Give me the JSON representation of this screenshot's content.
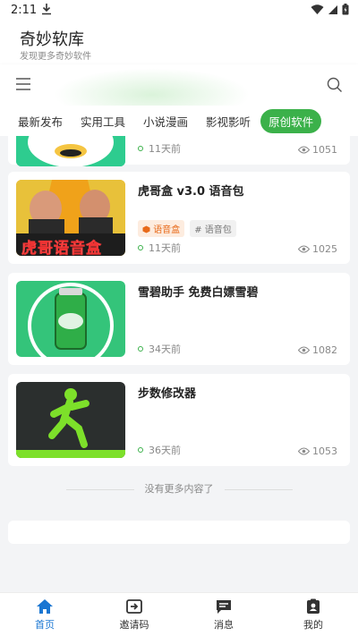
{
  "status": {
    "time": "2:11"
  },
  "header": {
    "title": "奇妙软库",
    "subtitle": "发现更多奇妙软件"
  },
  "tabs": [
    {
      "label": "最新发布"
    },
    {
      "label": "实用工具"
    },
    {
      "label": "小说漫画"
    },
    {
      "label": "影视影听"
    },
    {
      "label": "原创软件",
      "active": true
    }
  ],
  "items": [
    {
      "title": "",
      "time": "11天前",
      "views": "1051"
    },
    {
      "title": "虎哥盒 v3.0 语音包",
      "tags": [
        "语音盒",
        "# 语音包"
      ],
      "thumb_text": "虎哥语音盒",
      "time": "11天前",
      "views": "1025"
    },
    {
      "title": "雪碧助手 免费白嫖雪碧",
      "time": "34天前",
      "views": "1082"
    },
    {
      "title": "步数修改器",
      "time": "36天前",
      "views": "1053"
    }
  ],
  "list_end_text": "没有更多内容了",
  "nav": [
    {
      "label": "首页",
      "active": true
    },
    {
      "label": "邀请码"
    },
    {
      "label": "消息"
    },
    {
      "label": "我的"
    }
  ],
  "colors": {
    "accent_green": "#3bb14a",
    "nav_active": "#1976d2",
    "tag_orange": "#e86a1a"
  }
}
